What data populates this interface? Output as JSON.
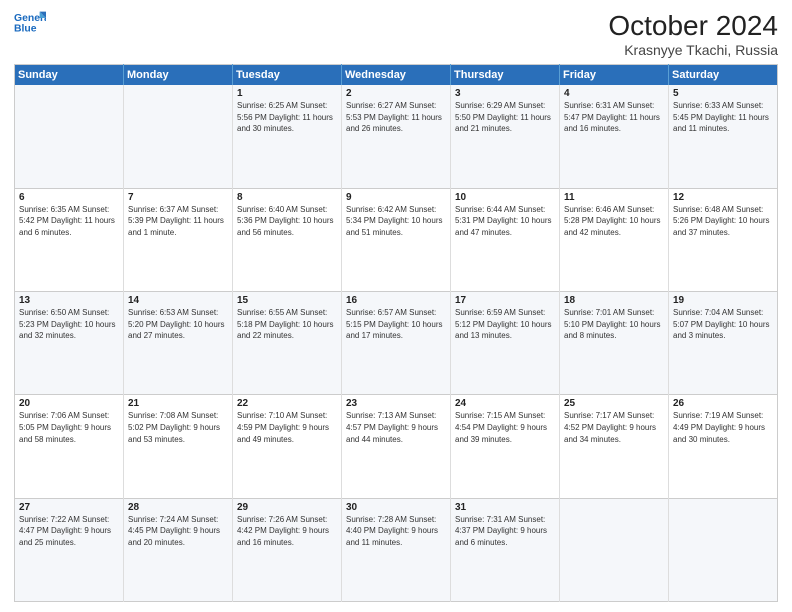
{
  "header": {
    "logo": {
      "line1": "General",
      "line2": "Blue"
    },
    "title": "October 2024",
    "subtitle": "Krasnyye Tkachi, Russia"
  },
  "days_of_week": [
    "Sunday",
    "Monday",
    "Tuesday",
    "Wednesday",
    "Thursday",
    "Friday",
    "Saturday"
  ],
  "weeks": [
    [
      {
        "day": "",
        "info": ""
      },
      {
        "day": "",
        "info": ""
      },
      {
        "day": "1",
        "info": "Sunrise: 6:25 AM\nSunset: 5:56 PM\nDaylight: 11 hours\nand 30 minutes."
      },
      {
        "day": "2",
        "info": "Sunrise: 6:27 AM\nSunset: 5:53 PM\nDaylight: 11 hours\nand 26 minutes."
      },
      {
        "day": "3",
        "info": "Sunrise: 6:29 AM\nSunset: 5:50 PM\nDaylight: 11 hours\nand 21 minutes."
      },
      {
        "day": "4",
        "info": "Sunrise: 6:31 AM\nSunset: 5:47 PM\nDaylight: 11 hours\nand 16 minutes."
      },
      {
        "day": "5",
        "info": "Sunrise: 6:33 AM\nSunset: 5:45 PM\nDaylight: 11 hours\nand 11 minutes."
      }
    ],
    [
      {
        "day": "6",
        "info": "Sunrise: 6:35 AM\nSunset: 5:42 PM\nDaylight: 11 hours\nand 6 minutes."
      },
      {
        "day": "7",
        "info": "Sunrise: 6:37 AM\nSunset: 5:39 PM\nDaylight: 11 hours\nand 1 minute."
      },
      {
        "day": "8",
        "info": "Sunrise: 6:40 AM\nSunset: 5:36 PM\nDaylight: 10 hours\nand 56 minutes."
      },
      {
        "day": "9",
        "info": "Sunrise: 6:42 AM\nSunset: 5:34 PM\nDaylight: 10 hours\nand 51 minutes."
      },
      {
        "day": "10",
        "info": "Sunrise: 6:44 AM\nSunset: 5:31 PM\nDaylight: 10 hours\nand 47 minutes."
      },
      {
        "day": "11",
        "info": "Sunrise: 6:46 AM\nSunset: 5:28 PM\nDaylight: 10 hours\nand 42 minutes."
      },
      {
        "day": "12",
        "info": "Sunrise: 6:48 AM\nSunset: 5:26 PM\nDaylight: 10 hours\nand 37 minutes."
      }
    ],
    [
      {
        "day": "13",
        "info": "Sunrise: 6:50 AM\nSunset: 5:23 PM\nDaylight: 10 hours\nand 32 minutes."
      },
      {
        "day": "14",
        "info": "Sunrise: 6:53 AM\nSunset: 5:20 PM\nDaylight: 10 hours\nand 27 minutes."
      },
      {
        "day": "15",
        "info": "Sunrise: 6:55 AM\nSunset: 5:18 PM\nDaylight: 10 hours\nand 22 minutes."
      },
      {
        "day": "16",
        "info": "Sunrise: 6:57 AM\nSunset: 5:15 PM\nDaylight: 10 hours\nand 17 minutes."
      },
      {
        "day": "17",
        "info": "Sunrise: 6:59 AM\nSunset: 5:12 PM\nDaylight: 10 hours\nand 13 minutes."
      },
      {
        "day": "18",
        "info": "Sunrise: 7:01 AM\nSunset: 5:10 PM\nDaylight: 10 hours\nand 8 minutes."
      },
      {
        "day": "19",
        "info": "Sunrise: 7:04 AM\nSunset: 5:07 PM\nDaylight: 10 hours\nand 3 minutes."
      }
    ],
    [
      {
        "day": "20",
        "info": "Sunrise: 7:06 AM\nSunset: 5:05 PM\nDaylight: 9 hours\nand 58 minutes."
      },
      {
        "day": "21",
        "info": "Sunrise: 7:08 AM\nSunset: 5:02 PM\nDaylight: 9 hours\nand 53 minutes."
      },
      {
        "day": "22",
        "info": "Sunrise: 7:10 AM\nSunset: 4:59 PM\nDaylight: 9 hours\nand 49 minutes."
      },
      {
        "day": "23",
        "info": "Sunrise: 7:13 AM\nSunset: 4:57 PM\nDaylight: 9 hours\nand 44 minutes."
      },
      {
        "day": "24",
        "info": "Sunrise: 7:15 AM\nSunset: 4:54 PM\nDaylight: 9 hours\nand 39 minutes."
      },
      {
        "day": "25",
        "info": "Sunrise: 7:17 AM\nSunset: 4:52 PM\nDaylight: 9 hours\nand 34 minutes."
      },
      {
        "day": "26",
        "info": "Sunrise: 7:19 AM\nSunset: 4:49 PM\nDaylight: 9 hours\nand 30 minutes."
      }
    ],
    [
      {
        "day": "27",
        "info": "Sunrise: 7:22 AM\nSunset: 4:47 PM\nDaylight: 9 hours\nand 25 minutes."
      },
      {
        "day": "28",
        "info": "Sunrise: 7:24 AM\nSunset: 4:45 PM\nDaylight: 9 hours\nand 20 minutes."
      },
      {
        "day": "29",
        "info": "Sunrise: 7:26 AM\nSunset: 4:42 PM\nDaylight: 9 hours\nand 16 minutes."
      },
      {
        "day": "30",
        "info": "Sunrise: 7:28 AM\nSunset: 4:40 PM\nDaylight: 9 hours\nand 11 minutes."
      },
      {
        "day": "31",
        "info": "Sunrise: 7:31 AM\nSunset: 4:37 PM\nDaylight: 9 hours\nand 6 minutes."
      },
      {
        "day": "",
        "info": ""
      },
      {
        "day": "",
        "info": ""
      }
    ]
  ]
}
